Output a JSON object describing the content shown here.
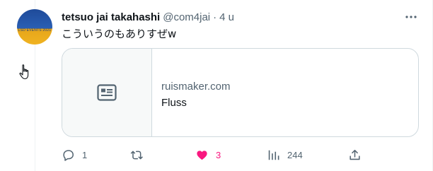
{
  "tweet": {
    "author_name": "tetsuo jai takahashi",
    "handle": "@com4jai",
    "separator": "·",
    "time": "4 u",
    "text": "こういうのもありすぜw",
    "avatar_text": "LSD EVENTS 2021"
  },
  "card": {
    "domain": "ruismaker.com",
    "title": "Fluss",
    "icon": "article-icon"
  },
  "actions": {
    "reply": {
      "icon": "reply-icon",
      "count": "1"
    },
    "retweet": {
      "icon": "retweet-icon",
      "count": ""
    },
    "like": {
      "icon": "heart-icon",
      "count": "3",
      "liked": true,
      "color": "#f91880"
    },
    "views": {
      "icon": "analytics-icon",
      "count": "244"
    },
    "share": {
      "icon": "share-icon"
    }
  },
  "colors": {
    "text_primary": "#0f1419",
    "text_secondary": "#536471",
    "border": "#cfd9de",
    "like": "#f91880"
  }
}
